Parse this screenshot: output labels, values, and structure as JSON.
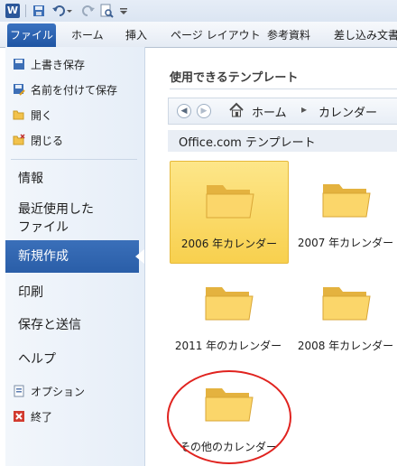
{
  "ribbon": {
    "tabs": [
      "ファイル",
      "ホーム",
      "挿入",
      "ページ レイアウト",
      "参考資料",
      "差し込み文書"
    ]
  },
  "nav": {
    "commands": [
      {
        "label": "上書き保存",
        "icon": "save-icon"
      },
      {
        "label": "名前を付けて保存",
        "icon": "save-as-icon"
      },
      {
        "label": "開く",
        "icon": "open-folder-icon"
      },
      {
        "label": "閉じる",
        "icon": "close-folder-icon"
      }
    ],
    "items": [
      "情報",
      "最近使用した\nファイル",
      "新規作成",
      "印刷",
      "保存と送信",
      "ヘルプ"
    ],
    "selected": "新規作成",
    "footer": [
      {
        "label": "オプション",
        "icon": "options-icon"
      },
      {
        "label": "終了",
        "icon": "exit-icon"
      }
    ]
  },
  "content": {
    "section_title": "使用できるテンプレート",
    "breadcrumb": [
      "ホーム",
      "カレンダー"
    ],
    "office_header": "Office.com テンプレート",
    "tiles": [
      "2006 年カレンダー",
      "2007 年カレンダー",
      "2011 年のカレンダー",
      "2008 年カレンダー",
      "その他のカレンダー"
    ],
    "selected_tile": "2006 年カレンダー"
  },
  "colors": {
    "file_tab": "#2a5ea8",
    "selected_nav": "#2a5ea8",
    "tile_selected": "#f8d04e",
    "highlight": "#e0231f"
  }
}
